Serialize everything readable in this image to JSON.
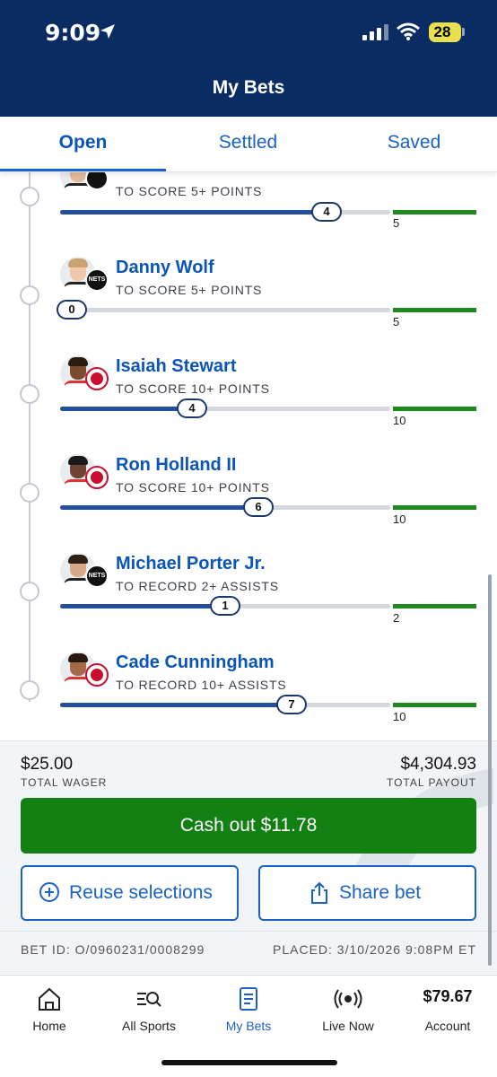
{
  "status_bar": {
    "time": "9:09",
    "battery": "28"
  },
  "header": {
    "title": "My Bets"
  },
  "tabs": [
    {
      "label": "Open",
      "active": true
    },
    {
      "label": "Settled",
      "active": false
    },
    {
      "label": "Saved",
      "active": false
    }
  ],
  "legs": [
    {
      "player": "",
      "market": "TO SCORE 5+ POINTS",
      "current": "4",
      "target": "5",
      "progress": 0.8,
      "team": "nets"
    },
    {
      "player": "Danny Wolf",
      "market": "TO SCORE 5+ POINTS",
      "current": "0",
      "target": "5",
      "progress": 0.0,
      "team": "nets"
    },
    {
      "player": "Isaiah Stewart",
      "market": "TO SCORE 10+ POINTS",
      "current": "4",
      "target": "10",
      "progress": 0.4,
      "team": "pistons"
    },
    {
      "player": "Ron Holland II",
      "market": "TO SCORE 10+ POINTS",
      "current": "6",
      "target": "10",
      "progress": 0.6,
      "team": "pistons"
    },
    {
      "player": "Michael Porter Jr.",
      "market": "TO RECORD 2+ ASSISTS",
      "current": "1",
      "target": "2",
      "progress": 0.5,
      "team": "nets"
    },
    {
      "player": "Cade Cunningham",
      "market": "TO RECORD 10+ ASSISTS",
      "current": "7",
      "target": "10",
      "progress": 0.7,
      "team": "pistons"
    }
  ],
  "summary": {
    "total_wager": "$25.00",
    "total_wager_label": "TOTAL WAGER",
    "total_payout": "$4,304.93",
    "total_payout_label": "TOTAL PAYOUT",
    "cash_out_label": "Cash out $11.78",
    "reuse_label": "Reuse selections",
    "share_label": "Share bet",
    "bet_id": "BET ID: O/0960231/0008299",
    "placed": "PLACED: 3/10/2026 9:08PM ET"
  },
  "bottom_nav": [
    {
      "label": "Home",
      "icon": "home-icon"
    },
    {
      "label": "All Sports",
      "icon": "search-list-icon"
    },
    {
      "label": "My Bets",
      "icon": "bet-slip-icon",
      "active": true
    },
    {
      "label": "Live Now",
      "icon": "live-broadcast-icon"
    },
    {
      "label": "Account",
      "balance": "$79.67"
    }
  ],
  "colors": {
    "brand_navy": "#0a2c63",
    "accent_blue": "#1a62c5",
    "cashout_green": "#128012",
    "target_green": "#1d8a1d",
    "progress_blue": "#244f9c"
  }
}
